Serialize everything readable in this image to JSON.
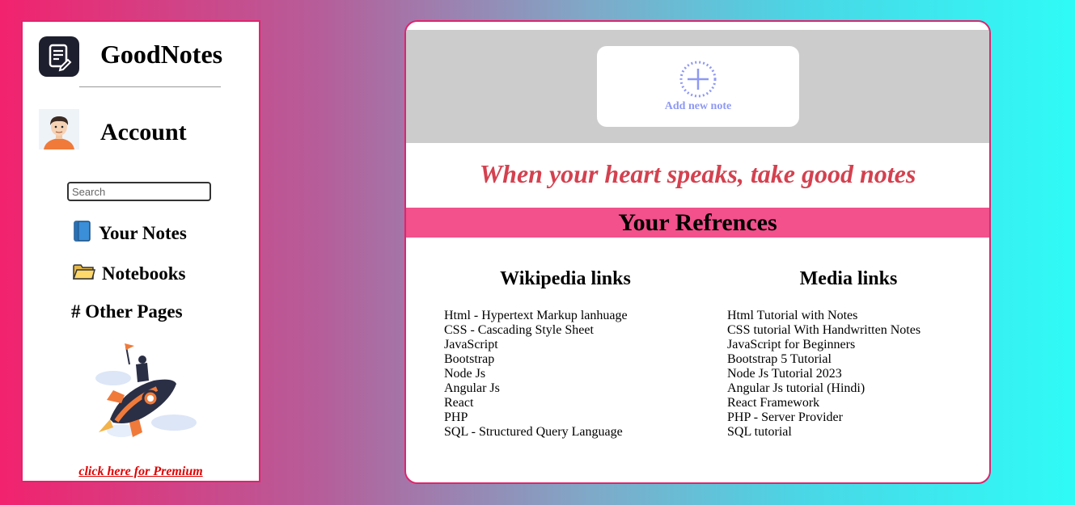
{
  "sidebar": {
    "app_title": "GoodNotes",
    "account_label": "Account",
    "search_placeholder": "Search",
    "nav": [
      {
        "icon": "blue-book-icon",
        "label": "Your Notes"
      },
      {
        "icon": "folder-icon",
        "label": "Notebooks"
      },
      {
        "icon": "hash",
        "label": "# Other Pages"
      }
    ],
    "premium_link": "click here for Premium"
  },
  "main": {
    "add_note_label": "Add new note",
    "tagline": "When your heart speaks, take good notes",
    "references_title": "Your Refrences",
    "wikipedia": {
      "heading": "Wikipedia links",
      "links": [
        "Html - Hypertext Markup lanhuage",
        "CSS - Cascading Style Sheet",
        "JavaScript",
        "Bootstrap",
        "Node Js",
        "Angular Js",
        "React",
        "PHP",
        "SQL - Structured Query Language"
      ]
    },
    "media": {
      "heading": "Media links",
      "links": [
        "Html Tutorial with Notes",
        "CSS tutorial With Handwritten Notes",
        "JavaScript for Beginners",
        "Bootstrap 5 Tutorial",
        "Node Js Tutorial 2023",
        "Angular Js tutorial (Hindi)",
        "React Framework",
        "PHP - Server Provider",
        "SQL tutorial"
      ]
    }
  },
  "colors": {
    "accent_border": "#e0246d",
    "tagline": "#d4414f",
    "ref_band": "#f2518b",
    "add_note": "#8e99f3",
    "premium": "#e00000"
  }
}
